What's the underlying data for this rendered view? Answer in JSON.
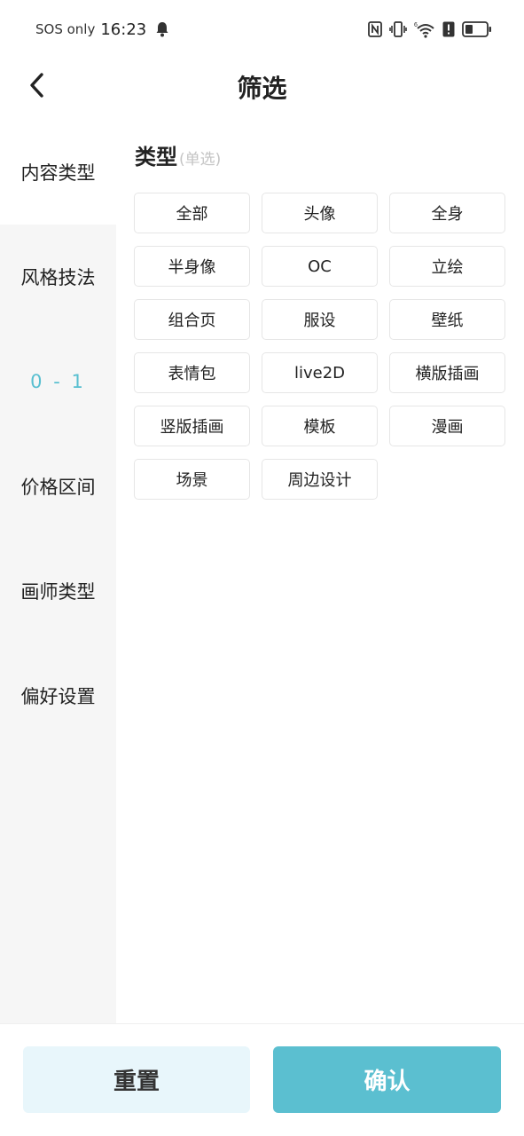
{
  "status_bar": {
    "carrier": "SOS only",
    "time": "16:23",
    "icons": [
      "bell-icon",
      "nfc-icon",
      "vibrate-icon",
      "wifi-icon",
      "alert-icon",
      "battery-icon"
    ],
    "wifi_badge": "6"
  },
  "header": {
    "title": "筛选",
    "back_icon": "chevron-left-icon"
  },
  "sidebar": {
    "items": [
      {
        "label": "内容类型",
        "active": true
      },
      {
        "label": "风格技法",
        "active": false
      },
      {
        "label": "0 - 1",
        "active": false
      },
      {
        "label": "价格区间",
        "active": false
      },
      {
        "label": "画师类型",
        "active": false
      },
      {
        "label": "偏好设置",
        "active": false
      }
    ]
  },
  "section": {
    "title": "类型",
    "subtitle": "(单选)"
  },
  "options": [
    "全部",
    "头像",
    "全身",
    "半身像",
    "OC",
    "立绘",
    "组合页",
    "服设",
    "壁纸",
    "表情包",
    "live2D",
    "横版插画",
    "竖版插画",
    "模板",
    "漫画",
    "场景",
    "周边设计"
  ],
  "footer": {
    "reset": "重置",
    "confirm": "确认"
  },
  "colors": {
    "accent": "#5bbfd0",
    "reset_bg": "#e8f6fb",
    "sidebar_bg": "#f6f6f6"
  }
}
